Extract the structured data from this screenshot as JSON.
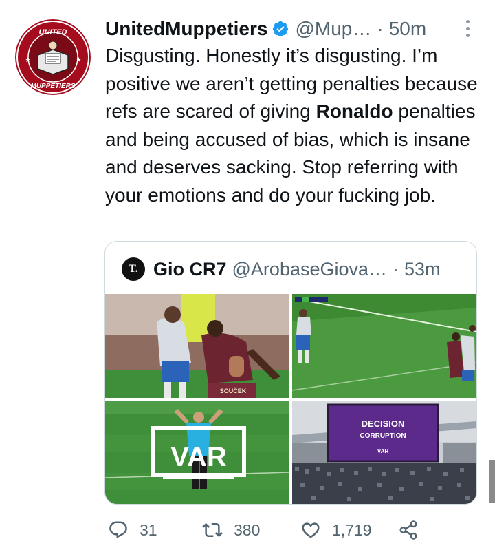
{
  "tweet": {
    "display_name": "UnitedMuppetiers",
    "handle": "@Mup…",
    "separator": "·",
    "time": "50m",
    "avatar_top_text": "UNITED",
    "avatar_bottom_text": "MUPPETIERS",
    "text_before": "Disgusting. Honestly it’s disgusting. I’m positive we aren’t getting penalties because refs are scared of giving ",
    "text_bold": "Ronaldo",
    "text_after": " penalties and being accused of bias, which is insane and deserves sacking. Stop referring with your emotions and do your fucking job."
  },
  "quote": {
    "avatar_letter": "T.",
    "display_name": "Gio CR7",
    "handle": "@ArobaseGiova…",
    "separator": "·",
    "time": "53m",
    "media": [
      {
        "kind": "photo",
        "desc": "players-tangle",
        "shirt_text": "SOUČEK"
      },
      {
        "kind": "photo",
        "desc": "broadcast-still"
      },
      {
        "kind": "photo",
        "desc": "referee-var-signal",
        "overlay_text": "VAR"
      },
      {
        "kind": "photo",
        "desc": "stadium-screen",
        "screen_line1": "DECISION",
        "screen_line2": "CORRUPTION",
        "screen_logo": "VAR"
      }
    ]
  },
  "actions": {
    "reply_count": "31",
    "retweet_count": "380",
    "like_count": "1,719"
  },
  "colors": {
    "accent": "#1d9bf0",
    "secondary_text": "#536471",
    "border": "#cfd9de",
    "avatar_red": "#c8102e"
  }
}
